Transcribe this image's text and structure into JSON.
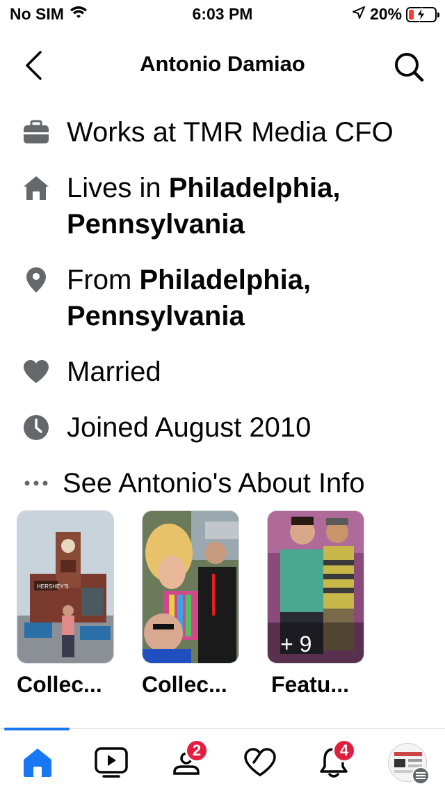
{
  "status_bar": {
    "carrier": "No SIM",
    "time": "6:03 PM",
    "battery": "20%",
    "battery_level": 0.2
  },
  "header": {
    "title": "Antonio Damiao"
  },
  "info": {
    "work": {
      "prefix": "Works at TMR Media CFO",
      "icon": "briefcase-icon"
    },
    "lives": {
      "prefix": "Lives in ",
      "place": "Philadelphia, Pennsylvania",
      "icon": "home-icon"
    },
    "from": {
      "prefix": "From ",
      "place": "Philadelphia, Pennsylvania",
      "icon": "location-pin-icon"
    },
    "relationship": {
      "text": "Married",
      "icon": "heart-icon"
    },
    "joined": {
      "text": "Joined August 2010",
      "icon": "clock-icon"
    },
    "about_link": {
      "text": "See Antonio's About Info",
      "icon": "more-dots-icon"
    }
  },
  "collections": [
    {
      "label": "Collec...",
      "image": "restaurant-exterior-photo"
    },
    {
      "label": "Collec...",
      "image": "group-selfie-photo"
    },
    {
      "label": "Featu...",
      "image": "two-men-photo",
      "overlay": "+ 9"
    }
  ],
  "tabbar": {
    "tabs": [
      {
        "name": "home",
        "active": true
      },
      {
        "name": "watch"
      },
      {
        "name": "groups",
        "badge": "2"
      },
      {
        "name": "dating"
      },
      {
        "name": "notifications",
        "badge": "4"
      },
      {
        "name": "menu"
      }
    ]
  },
  "colors": {
    "accent": "#1877f2",
    "badge": "#e41e3f",
    "icon_gray": "#65676b"
  }
}
